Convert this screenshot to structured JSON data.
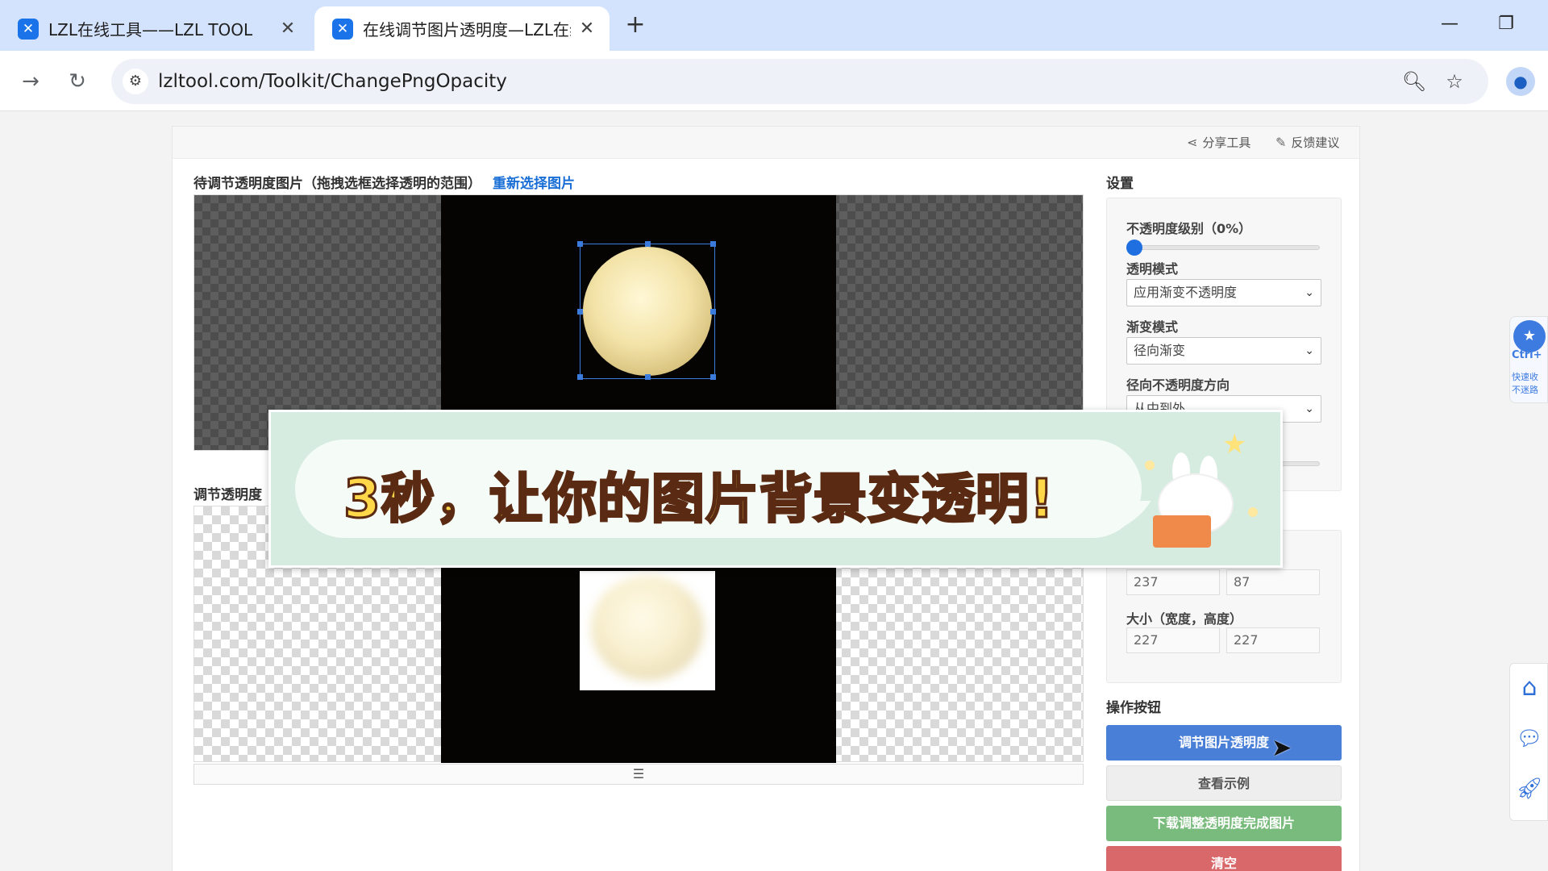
{
  "browser": {
    "tabs": [
      {
        "title": "LZL在线工具——LZL TOOL",
        "active": false
      },
      {
        "title": "在线调节图片透明度—LZL在线",
        "active": true
      }
    ],
    "url": "lzltool.com/Toolkit/ChangePngOpacity"
  },
  "header": {
    "share": "分享工具",
    "feedback": "反馈建议"
  },
  "main": {
    "source_title": "待调节透明度图片（拖拽选框选择透明的范围）",
    "reselect": "重新选择图片",
    "result_title": "调节透明度",
    "result_toggle_icon": "list-icon"
  },
  "settings": {
    "title": "设置",
    "opacity_label": "不透明度级别（0%）",
    "opacity_value": 0,
    "transparent_mode_label": "透明模式",
    "transparent_mode_value": "应用渐变不透明度",
    "gradient_mode_label": "渐变模式",
    "gradient_mode_value": "径向渐变",
    "radial_direction_label": "径向不透明度方向",
    "radial_direction_value": "从中到外",
    "position_x": "237",
    "position_y": "87",
    "size_label": "大小（宽度，高度）",
    "size_w": "227",
    "size_h": "227"
  },
  "actions": {
    "title": "操作按钮",
    "adjust": "调节图片透明度",
    "example": "查看示例",
    "download": "下载调整透明度完成图片",
    "clear": "清空"
  },
  "banner": {
    "text": "3秒，让你的图片背景变透明!"
  },
  "side": {
    "ctrl_hint": "Ctrl+",
    "quick_fav": "快速收",
    "no_lose": "不迷路"
  },
  "colors": {
    "primary_blue": "#4a7fd8",
    "gray_button": "#eeeeee",
    "green_button": "#79bb7c",
    "red_button": "#d9686a",
    "link_blue": "#1a6fd6"
  }
}
